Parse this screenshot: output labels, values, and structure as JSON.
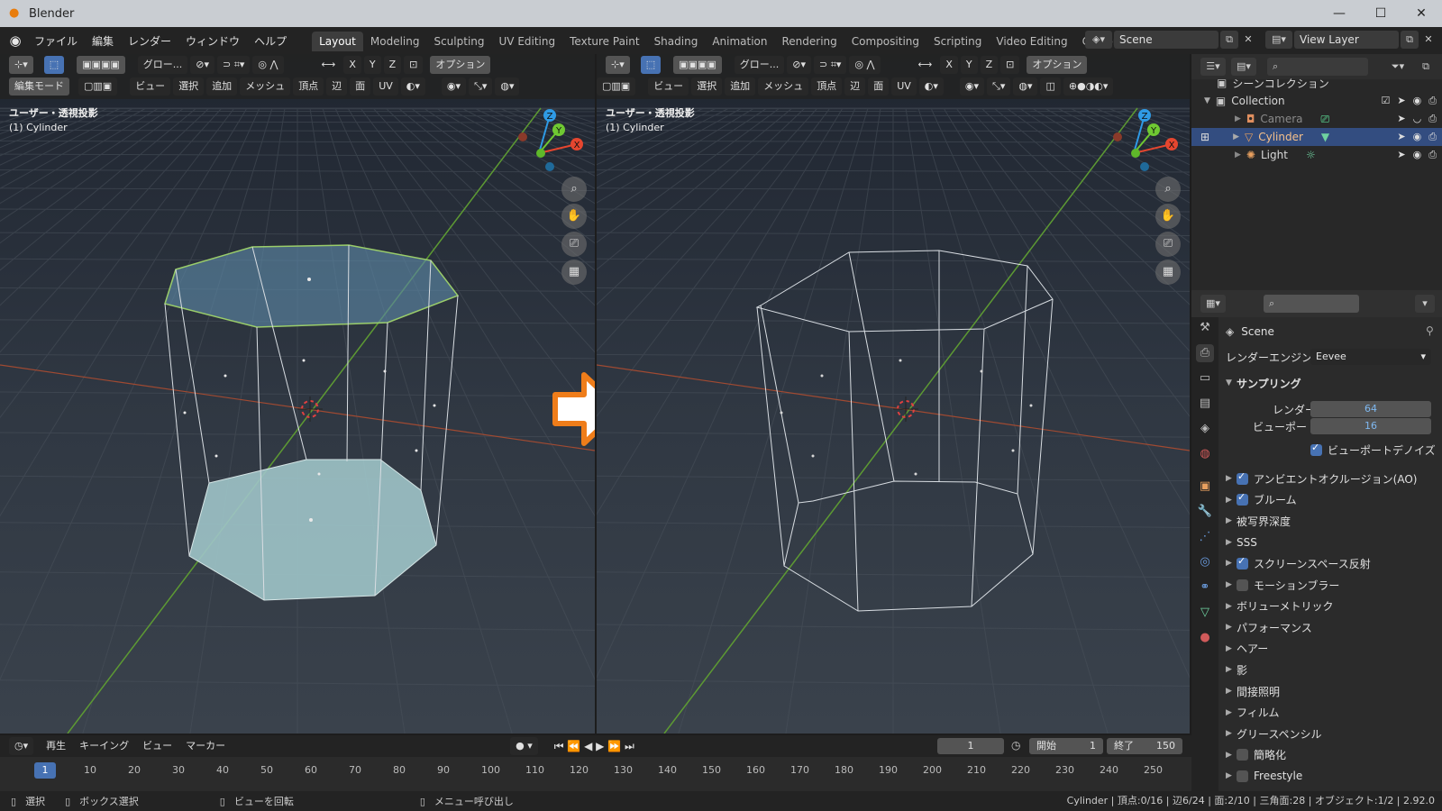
{
  "window": {
    "title": "Blender",
    "minimize": "—",
    "maximize": "☐",
    "close": "✕"
  },
  "menu": [
    "ファイル",
    "編集",
    "レンダー",
    "ウィンドウ",
    "ヘルプ"
  ],
  "workspaces": [
    "Layout",
    "Modeling",
    "Sculpting",
    "UV Editing",
    "Texture Paint",
    "Shading",
    "Animation",
    "Rendering",
    "Compositing",
    "Scripting",
    "Video Editing",
    "Custom"
  ],
  "workspace_add": "+",
  "scene": "Scene",
  "view_layer": "View Layer",
  "viewport_left": {
    "transform": "グロー...",
    "options": "オプション",
    "mode": "編集モード",
    "menus": [
      "ビュー",
      "選択",
      "追加",
      "メッシュ",
      "頂点",
      "辺",
      "面",
      "UV"
    ],
    "axes": [
      "X",
      "Y",
      "Z"
    ],
    "view_label": "ユーザー・透視投影",
    "object_label": "(1) Cylinder"
  },
  "viewport_right": {
    "transform": "グロー...",
    "options": "オプション",
    "menus": [
      "ビュー",
      "選択",
      "追加",
      "メッシュ",
      "頂点",
      "辺",
      "面",
      "UV"
    ],
    "axes": [
      "X",
      "Y",
      "Z"
    ],
    "view_label": "ユーザー・透視投影",
    "object_label": "(1) Cylinder"
  },
  "gizmo": {
    "x": "X",
    "y": "Y",
    "z": "Z"
  },
  "outliner": {
    "root": "シーンコレクション",
    "collection": "Collection",
    "items": [
      "Camera",
      "Cylinder",
      "Light"
    ]
  },
  "properties": {
    "scene_name": "Scene",
    "render_engine_label": "レンダーエンジン",
    "render_engine": "Eevee",
    "sampling": "サンプリング",
    "render_label": "レンダー",
    "render_value": "64",
    "viewport_label": "ビューポート",
    "viewport_value": "16",
    "viewport_denoise": "ビューポートデノイズ",
    "panels": [
      {
        "label": "アンビエントオクルージョン(AO)",
        "check": "on"
      },
      {
        "label": "ブルーム",
        "check": "on"
      },
      {
        "label": "被写界深度",
        "check": "none"
      },
      {
        "label": "SSS",
        "check": "none"
      },
      {
        "label": "スクリーンスペース反射",
        "check": "on"
      },
      {
        "label": "モーションブラー",
        "check": "off"
      },
      {
        "label": "ボリューメトリック",
        "check": "none"
      },
      {
        "label": "パフォーマンス",
        "check": "none"
      },
      {
        "label": "ヘアー",
        "check": "none"
      },
      {
        "label": "影",
        "check": "none"
      },
      {
        "label": "間接照明",
        "check": "none"
      },
      {
        "label": "フィルム",
        "check": "none"
      },
      {
        "label": "グリースペンシル",
        "check": "none"
      },
      {
        "label": "簡略化",
        "check": "off"
      },
      {
        "label": "Freestyle",
        "check": "off"
      }
    ]
  },
  "timeline": {
    "play": "再生",
    "keying": "キーイング",
    "view": "ビュー",
    "marker": "マーカー",
    "current_frame": "1",
    "start_label": "開始",
    "start": "1",
    "end_label": "終了",
    "end": "150",
    "ticks": [
      "1",
      "10",
      "20",
      "30",
      "40",
      "50",
      "60",
      "70",
      "80",
      "90",
      "100",
      "110",
      "120",
      "130",
      "140",
      "150",
      "160",
      "170",
      "180",
      "190",
      "200",
      "210",
      "220",
      "230",
      "240",
      "250"
    ]
  },
  "status": {
    "select": "選択",
    "box_select": "ボックス選択",
    "rotate_view": "ビューを回転",
    "call_menu": "メニュー呼び出し",
    "stats": "Cylinder | 頂点:0/16 | 辺6/24 | 面:2/10 | 三角面:28 | オブジェクト:1/2 | 2.92.0"
  },
  "colors": {
    "accent": "#4772b3",
    "arrow": "#ef7d1a",
    "selected_face": "#9ec4c8",
    "x_axis": "#e5462f",
    "y_axis": "#6fc832",
    "z_axis": "#2f9ae5"
  }
}
